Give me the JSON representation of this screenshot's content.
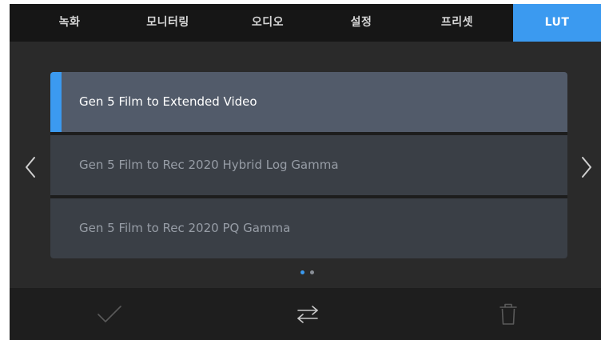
{
  "tabs": [
    {
      "label": "녹화",
      "active": false
    },
    {
      "label": "모니터링",
      "active": false
    },
    {
      "label": "오디오",
      "active": false
    },
    {
      "label": "설정",
      "active": false
    },
    {
      "label": "프리셋",
      "active": false
    },
    {
      "label": "LUT",
      "active": true
    }
  ],
  "lut_list": {
    "items": [
      {
        "label": "Gen 5 Film to Extended Video",
        "selected": true
      },
      {
        "label": "Gen 5 Film to Rec 2020 Hybrid Log Gamma",
        "selected": false
      },
      {
        "label": "Gen 5 Film to Rec 2020 PQ Gamma",
        "selected": false
      }
    ]
  },
  "pagination": {
    "pages": 2,
    "current": 1
  },
  "toolbar": {
    "icons": [
      "checkmark-icon",
      "swap-arrows-icon",
      "trash-icon"
    ]
  },
  "colors": {
    "accent": "#3b9af0",
    "background": "#2a2a2a",
    "tab_bar": "#161616",
    "selected_item": "#525b6a",
    "item": "#3a3f46",
    "toolbar": "#1e1e1e"
  }
}
